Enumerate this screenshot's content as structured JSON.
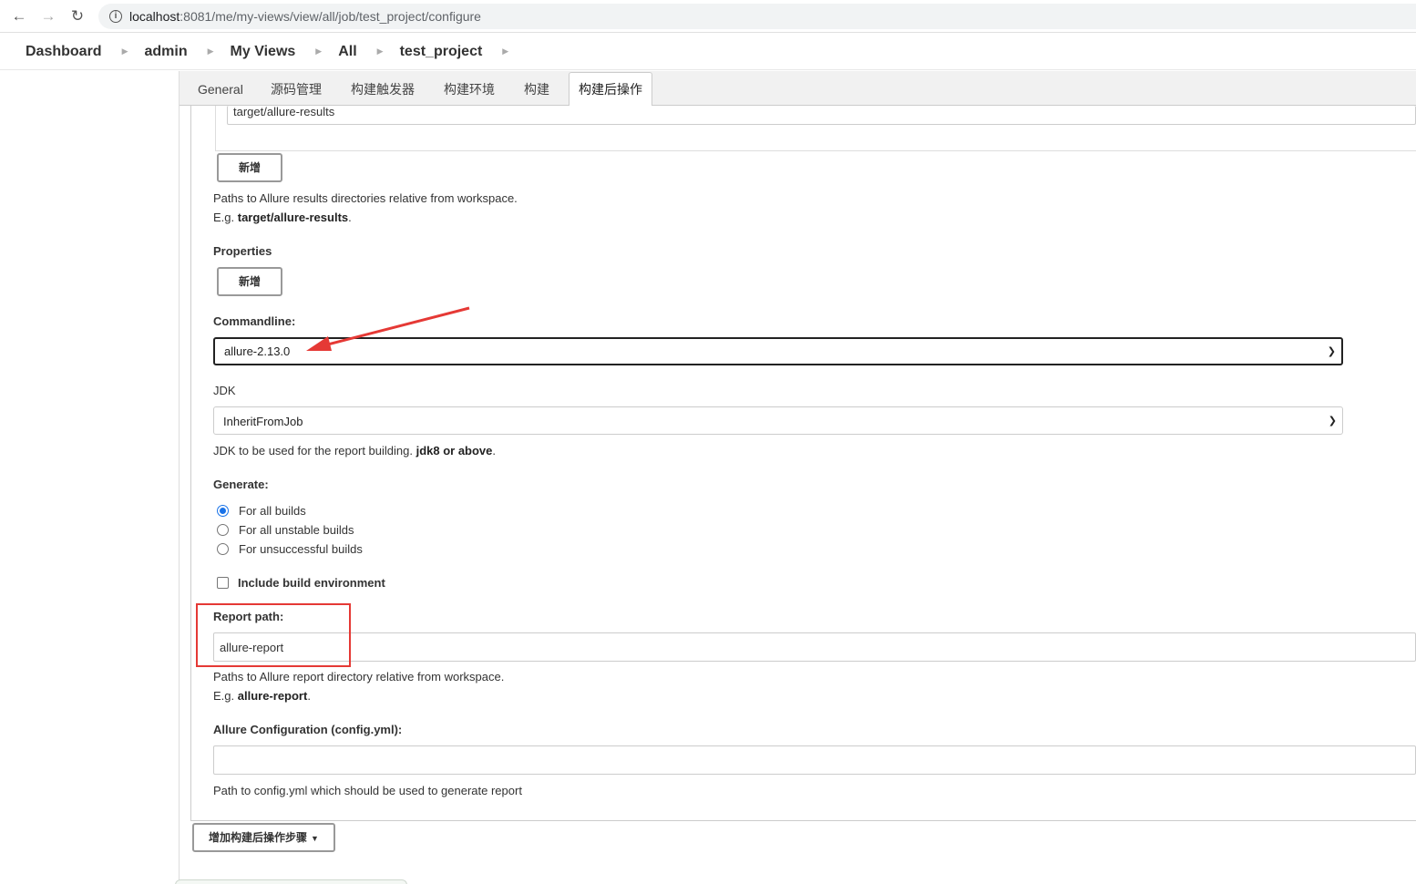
{
  "browser": {
    "url_host": "localhost",
    "url_rest": ":8081/me/my-views/view/all/job/test_project/configure"
  },
  "breadcrumb": [
    "Dashboard",
    "admin",
    "My Views",
    "All",
    "test_project"
  ],
  "tabs": [
    {
      "label": "General",
      "active": false
    },
    {
      "label": "源码管理",
      "active": false
    },
    {
      "label": "构建触发器",
      "active": false
    },
    {
      "label": "构建环境",
      "active": false
    },
    {
      "label": "构建",
      "active": false
    },
    {
      "label": "构建后操作",
      "active": true
    }
  ],
  "form": {
    "results_path_value": "target/allure-results",
    "add_label": "新增",
    "results_help_line1": "Paths to Allure results directories relative from workspace.",
    "results_help_eg_prefix": "E.g. ",
    "results_help_eg_value": "target/allure-results",
    "results_help_eg_suffix": ".",
    "properties_label": "Properties",
    "properties_add_label": "新增",
    "commandline_label": "Commandline:",
    "commandline_value": "allure-2.13.0",
    "jdk_label": "JDK",
    "jdk_value": "InheritFromJob",
    "jdk_help_prefix": "JDK to be used for the report building. ",
    "jdk_help_bold": "jdk8 or above",
    "jdk_help_suffix": ".",
    "generate_label": "Generate:",
    "generate_options": [
      {
        "label": "For all builds",
        "checked": true
      },
      {
        "label": "For all unstable builds",
        "checked": false
      },
      {
        "label": "For unsuccessful builds",
        "checked": false
      }
    ],
    "include_env_label": "Include build environment",
    "include_env_checked": false,
    "report_path_label": "Report path:",
    "report_path_value": "allure-report",
    "report_help_line1": "Paths to Allure report directory relative from workspace.",
    "report_help_eg_prefix": "E.g. ",
    "report_help_eg_value": "allure-report",
    "report_help_eg_suffix": ".",
    "config_label": "Allure Configuration (config.yml):",
    "config_value": "",
    "config_help": "Path to config.yml which should be used to generate report",
    "add_step_label": "增加构建后操作步骤"
  },
  "colors": {
    "highlight": "#e53935",
    "radio_accent": "#1a73e8"
  }
}
